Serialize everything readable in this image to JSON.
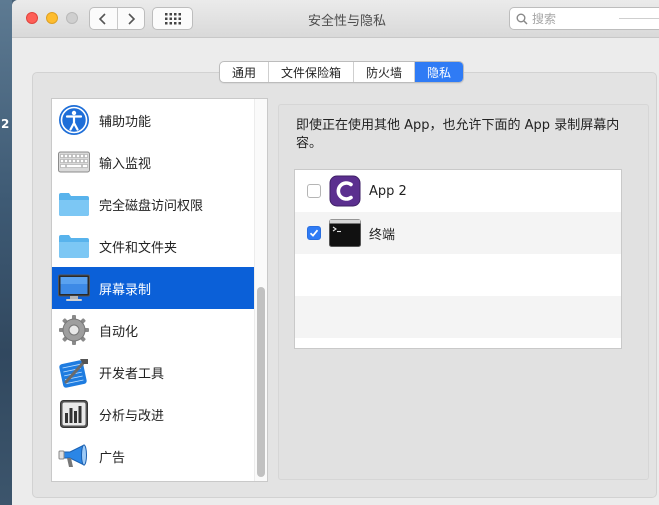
{
  "desktop": {
    "label": "2"
  },
  "window": {
    "title": "安全性与隐私",
    "search_placeholder": "搜索"
  },
  "tabs": [
    {
      "label": "通用",
      "active": false
    },
    {
      "label": "文件保险箱",
      "active": false
    },
    {
      "label": "防火墙",
      "active": false
    },
    {
      "label": "隐私",
      "active": true
    }
  ],
  "sidebar": {
    "items": [
      {
        "label": "辅助功能",
        "icon": "accessibility-icon"
      },
      {
        "label": "输入监视",
        "icon": "keyboard-icon"
      },
      {
        "label": "完全磁盘访问权限",
        "icon": "folder-icon"
      },
      {
        "label": "文件和文件夹",
        "icon": "folder-icon"
      },
      {
        "label": "屏幕录制",
        "icon": "display-icon",
        "selected": true
      },
      {
        "label": "自动化",
        "icon": "gear-icon"
      },
      {
        "label": "开发者工具",
        "icon": "developer-tools-icon"
      },
      {
        "label": "分析与改进",
        "icon": "analytics-icon"
      },
      {
        "label": "广告",
        "icon": "megaphone-icon"
      }
    ]
  },
  "main": {
    "description": "即使正在使用其他 App，也允许下面的 App 录制屏幕内容。",
    "apps": [
      {
        "name": "App 2",
        "checked": false,
        "icon": "app2-icon"
      },
      {
        "name": "终端",
        "checked": true,
        "icon": "terminal-icon"
      }
    ]
  },
  "colors": {
    "accent": "#2f7bf5",
    "selection": "#0b60d8"
  }
}
